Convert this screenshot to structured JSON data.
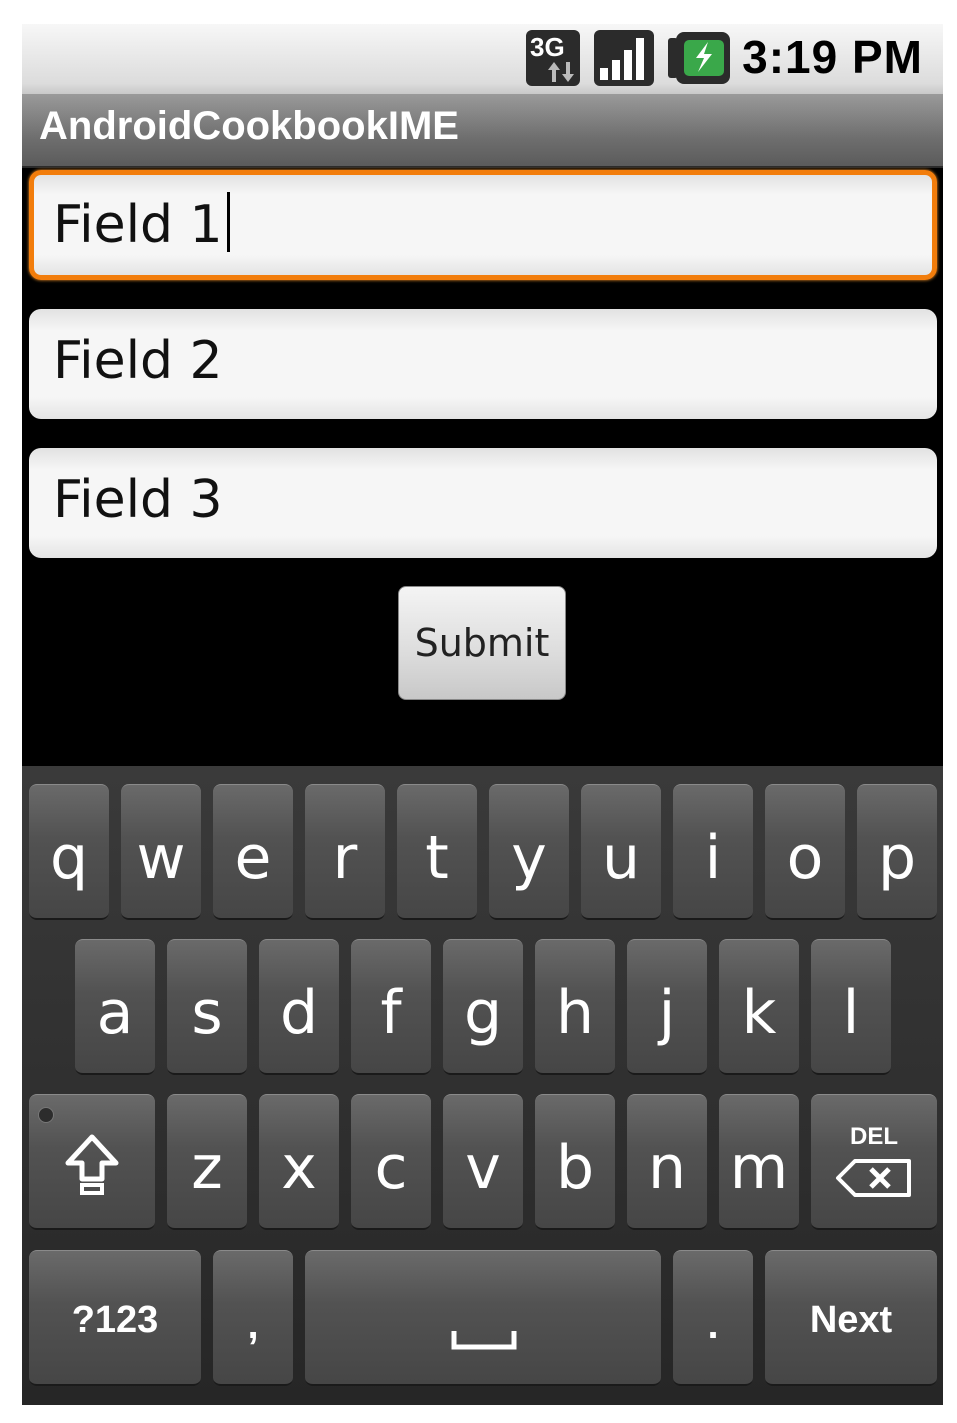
{
  "status_bar": {
    "network_label": "3G",
    "time": "3:19 PM",
    "icons": [
      "3g-data-icon",
      "signal-strength-icon",
      "battery-charging-icon"
    ]
  },
  "title_bar": {
    "title": "AndroidCookbookIME"
  },
  "form": {
    "fields": [
      {
        "value": "Field 1",
        "focused": true
      },
      {
        "value": "Field 2",
        "focused": false
      },
      {
        "value": "Field 3",
        "focused": false
      }
    ],
    "submit_label": "Submit"
  },
  "keyboard": {
    "row1": [
      "q",
      "w",
      "e",
      "r",
      "t",
      "y",
      "u",
      "i",
      "o",
      "p"
    ],
    "row2": [
      "a",
      "s",
      "d",
      "f",
      "g",
      "h",
      "j",
      "k",
      "l"
    ],
    "row3": [
      "z",
      "x",
      "c",
      "v",
      "b",
      "n",
      "m"
    ],
    "del_label": "DEL",
    "symbols_label": "?123",
    "comma_label": ",",
    "period_label": ".",
    "next_label": "Next",
    "icons": [
      "shift-icon",
      "backspace-icon",
      "space-icon"
    ]
  },
  "colors": {
    "focus_border": "#f27d0c",
    "background": "#000000",
    "key": "#4f4f4f"
  }
}
